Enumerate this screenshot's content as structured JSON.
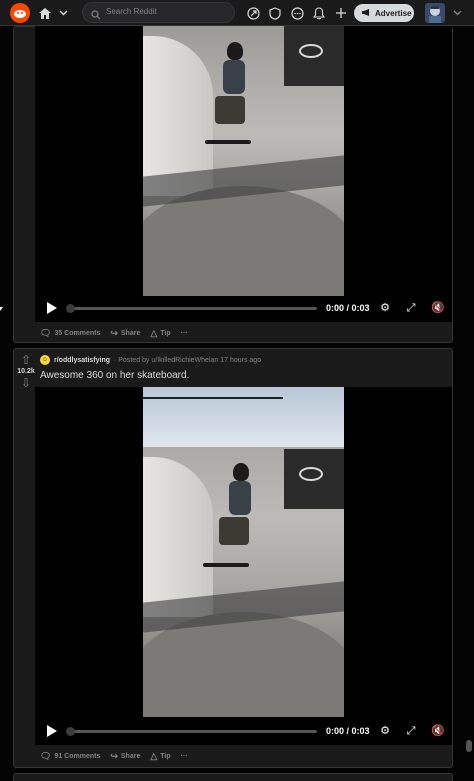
{
  "header": {
    "search_placeholder": "Search Reddit",
    "advertise_label": "Advertise",
    "icons": [
      "home-icon",
      "chevron-down-icon",
      "popular-icon",
      "shield-icon",
      "chat-icon",
      "bell-icon",
      "plus-icon"
    ]
  },
  "posts": [
    {
      "comments_label": "35 Comments",
      "share_label": "Share",
      "tip_label": "Tip",
      "more_label": "···",
      "time_label": "0:00 / 0:03"
    },
    {
      "subreddit": "r/oddlysatisfying",
      "posted_by": "· Posted by u/IkilledRichieWhelan 17 hours ago",
      "score": "10.2k",
      "title": "Awesome 360 on her skateboard.",
      "comments_label": "91 Comments",
      "share_label": "Share",
      "tip_label": "Tip",
      "more_label": "···",
      "time_label": "0:00 / 0:03"
    }
  ],
  "colors": {
    "accent": "#ff4500",
    "background": "#030303",
    "card": "#1a1a1b",
    "subreddit_icon": "#ffd635"
  }
}
